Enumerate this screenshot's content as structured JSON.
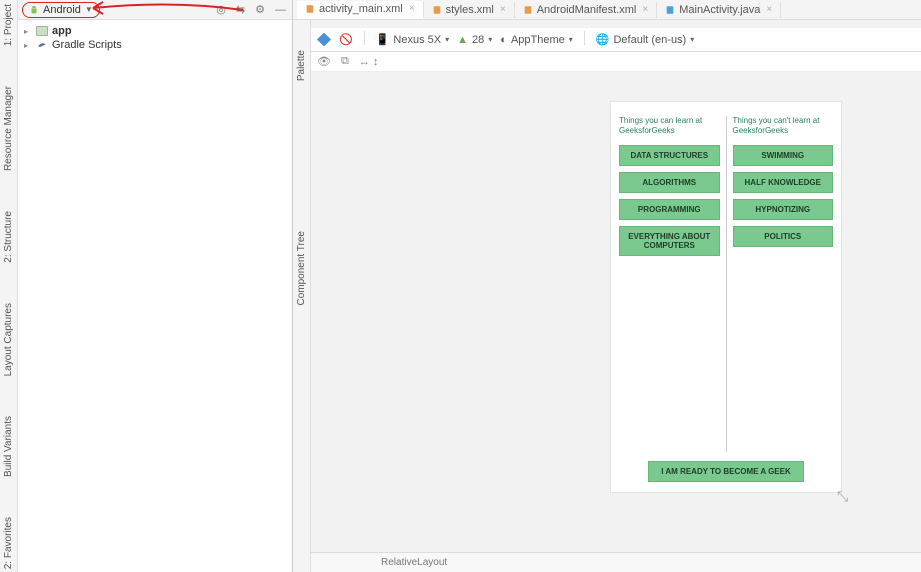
{
  "leftRail": {
    "project": "1: Project",
    "resourceManager": "Resource Manager",
    "structure": "2: Structure",
    "layoutCaptures": "Layout Captures",
    "buildVariants": "Build Variants",
    "favorites": "2: Favorites"
  },
  "projectPanel": {
    "selector": "Android",
    "tree": {
      "app": "app",
      "gradle": "Gradle Scripts"
    }
  },
  "tabs": [
    {
      "label": "activity_main.xml",
      "active": true,
      "iconColor": "#e79b4c"
    },
    {
      "label": "styles.xml",
      "active": false,
      "iconColor": "#e79b4c"
    },
    {
      "label": "AndroidManifest.xml",
      "active": false,
      "iconColor": "#e79b4c"
    },
    {
      "label": "MainActivity.java",
      "active": false,
      "iconColor": "#4aa0d9"
    }
  ],
  "designToolbar": {
    "device": "Nexus 5X",
    "api": "28",
    "theme": "AppTheme",
    "locale": "Default (en-us)"
  },
  "innerRail": {
    "palette": "Palette",
    "componentTree": "Component Tree"
  },
  "subTool": {
    "zoomOut": "⊖",
    "zoomFit": "⛶",
    "arrows": "↔  ↕"
  },
  "preview": {
    "col1Title": "Things you can learn at GeeksforGeeks",
    "col2Title": "Things you can't learn at GeeksforGeeks",
    "col1": [
      "DATA STRUCTURES",
      "ALGORITHMS",
      "PROGRAMMING",
      "EVERYTHING ABOUT COMPUTERS"
    ],
    "col2": [
      "SWIMMING",
      "HALF KNOWLEDGE",
      "HYPNOTIZING",
      "POLITICS"
    ],
    "cta": "I AM READY TO BECOME A GEEK"
  },
  "status": {
    "layout": "RelativeLayout"
  }
}
